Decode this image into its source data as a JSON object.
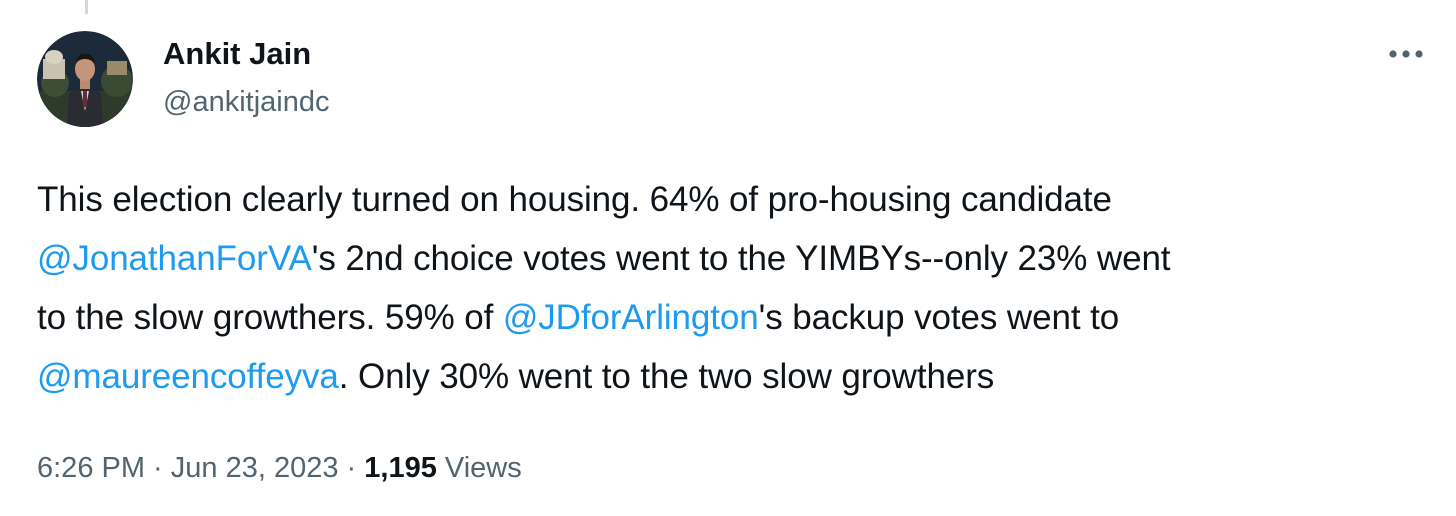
{
  "author": {
    "display_name": "Ankit Jain",
    "handle": "@ankitjaindc"
  },
  "tweet": {
    "line1": "This election clearly turned on housing. 64% of pro-housing candidate",
    "mention1": "@JonathanForVA",
    "line2_rest": "'s 2nd choice votes went to the YIMBYs--only 23% went",
    "line3_start": "to the slow growthers. 59% of ",
    "mention2": "@JDforArlington",
    "line3_rest": "'s backup votes went to",
    "mention3": "@maureencoffeyva",
    "line4_rest": ". Only 30% went to the two slow growthers"
  },
  "meta": {
    "time": "6:26 PM",
    "sep1": " · ",
    "date": "Jun 23, 2023",
    "sep2": " · ",
    "views_count": "1,195",
    "views_label": " Views"
  },
  "icons": {
    "more": "more-horizontal-icon",
    "avatar": "profile-photo"
  },
  "colors": {
    "link": "#1d9bf0",
    "text": "#0f1419",
    "secondary": "#536471"
  }
}
